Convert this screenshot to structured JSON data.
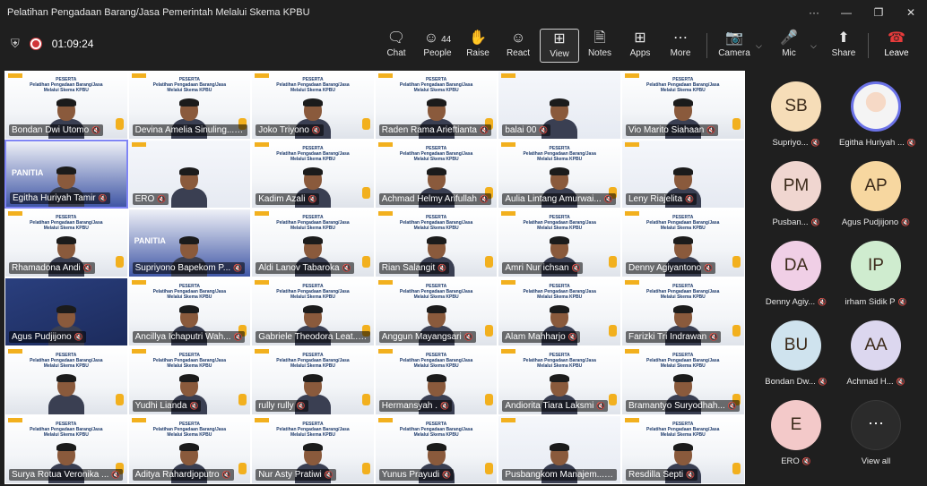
{
  "window": {
    "title": "Pelatihan Pengadaan Barang/Jasa Pemerintah Melalui Skema KPBU",
    "more": "···",
    "minimize": "—",
    "restore": "❐",
    "close": "✕"
  },
  "meeting": {
    "timer": "01:09:24"
  },
  "toolbar": {
    "chat": "Chat",
    "people": "People",
    "people_count": "44",
    "raise": "Raise",
    "react": "React",
    "view": "View",
    "notes": "Notes",
    "apps": "Apps",
    "more": "More",
    "camera": "Camera",
    "mic": "Mic",
    "share": "Share",
    "leave": "Leave"
  },
  "slide_header": {
    "title": "PESERTA",
    "line1": "Pelatihan Pengadaan Barang/Jasa",
    "line2": "Melalui Skema KPBU"
  },
  "panitia_label": "PANITIA",
  "tiles": [
    {
      "name": "Bondan Dwi Utomo",
      "style": "plain"
    },
    {
      "name": "Devina Amelia Sinuling...",
      "style": "plain"
    },
    {
      "name": "Joko Triyono",
      "style": "plain"
    },
    {
      "name": "Raden Rama Arieftianta",
      "style": "plain"
    },
    {
      "name": "balai 00",
      "style": "office"
    },
    {
      "name": "Vio Marito Siahaan",
      "style": "plain"
    },
    {
      "name": "Egitha Huriyah Tamir",
      "style": "panitia"
    },
    {
      "name": "ERO",
      "style": "office"
    },
    {
      "name": "Kadim Azali",
      "style": "plain"
    },
    {
      "name": "Achmad Helmy Arifullah",
      "style": "plain"
    },
    {
      "name": "Aulia Lintang Amurwai...",
      "style": "plain"
    },
    {
      "name": "Leny Riajelita",
      "style": "office"
    },
    {
      "name": "Rhamadona Andi",
      "style": "plain"
    },
    {
      "name": "Supriyono Bapekom P...",
      "style": "panitia"
    },
    {
      "name": "Aldi Lanov Tabaroka",
      "style": "plain"
    },
    {
      "name": "Rian Salangit",
      "style": "plain"
    },
    {
      "name": "Amri Nur ichsan",
      "style": "plain"
    },
    {
      "name": "Denny Agiyantono",
      "style": "plain"
    },
    {
      "name": "Agus Pudjijono",
      "style": "blue"
    },
    {
      "name": "Ancillya Ichaputri Wah...",
      "style": "plain"
    },
    {
      "name": "Gabriele Theodora Leat...",
      "style": "plain"
    },
    {
      "name": "Anggun Mayangsari",
      "style": "plain"
    },
    {
      "name": "Alam Mahharjo",
      "style": "plain"
    },
    {
      "name": "Farizki Tri Indrawan",
      "style": "plain"
    },
    {
      "name": "",
      "style": "plain"
    },
    {
      "name": "Yudhi Lianda",
      "style": "plain"
    },
    {
      "name": "rully rully",
      "style": "plain"
    },
    {
      "name": "Hermansyah .",
      "style": "plain"
    },
    {
      "name": "Andiorita Tiara Laksmi",
      "style": "plain"
    },
    {
      "name": "Bramantyo Suryodhah...",
      "style": "plain"
    },
    {
      "name": "Surya Rotua Veronika ...",
      "style": "plain"
    },
    {
      "name": "Aditya Rahardjoputro",
      "style": "plain"
    },
    {
      "name": "Nur Asty Pratiwi",
      "style": "plain"
    },
    {
      "name": "Yunus Prayudi",
      "style": "plain"
    },
    {
      "name": "Pusbangkom Manajem...",
      "style": "office"
    },
    {
      "name": "Resdilla Septi",
      "style": "plain"
    }
  ],
  "side_participants": [
    {
      "initials": "SB",
      "label": "Supriyo...",
      "color": "#f6ddb8"
    },
    {
      "initials": "",
      "label": "Egitha Huriyah ...",
      "color": "#f4f4f4",
      "photo": true
    },
    {
      "initials": "PM",
      "label": "Pusban...",
      "color": "#f0d6d0"
    },
    {
      "initials": "AP",
      "label": "Agus Pudjijono",
      "color": "#f7d7a0"
    },
    {
      "initials": "DA",
      "label": "Denny Agiy...",
      "color": "#f0cfe6"
    },
    {
      "initials": "IP",
      "label": "irham Sidik P",
      "color": "#cfeccf"
    },
    {
      "initials": "BU",
      "label": "Bondan Dw...",
      "color": "#cfe3ee"
    },
    {
      "initials": "AA",
      "label": "Achmad H...",
      "color": "#dcd7ef"
    },
    {
      "initials": "E",
      "label": "ERO",
      "color": "#f3c9c9"
    },
    {
      "initials": "⋯",
      "label": "View all",
      "color": "#2b2b2b",
      "more": true
    }
  ]
}
